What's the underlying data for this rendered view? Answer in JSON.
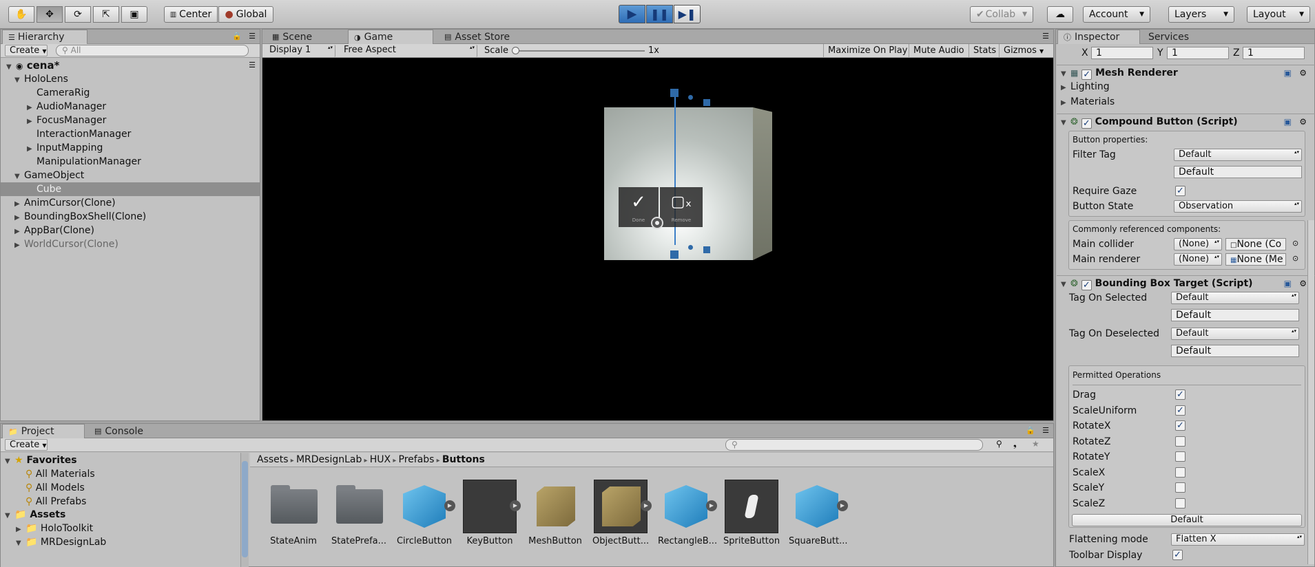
{
  "toolbar": {
    "pivot_center": "Center",
    "pivot_global": "Global",
    "collab": "Collab",
    "account": "Account",
    "layers": "Layers",
    "layout": "Layout"
  },
  "hierarchy": {
    "tab": "Hierarchy",
    "create": "Create",
    "search_placeholder": "All",
    "scene": "cena*",
    "items": [
      {
        "label": "HoloLens",
        "indent": 0,
        "arrow": "open",
        "muted": false
      },
      {
        "label": "CameraRig",
        "indent": 1,
        "arrow": "none",
        "muted": false
      },
      {
        "label": "AudioManager",
        "indent": 1,
        "arrow": "closed",
        "muted": false
      },
      {
        "label": "FocusManager",
        "indent": 1,
        "arrow": "closed",
        "muted": false
      },
      {
        "label": "InteractionManager",
        "indent": 1,
        "arrow": "none",
        "muted": false
      },
      {
        "label": "InputMapping",
        "indent": 1,
        "arrow": "closed",
        "muted": false
      },
      {
        "label": "ManipulationManager",
        "indent": 1,
        "arrow": "none",
        "muted": false
      },
      {
        "label": "GameObject",
        "indent": 0,
        "arrow": "open",
        "muted": false
      },
      {
        "label": "Cube",
        "indent": 1,
        "arrow": "none",
        "muted": false,
        "selected": true
      },
      {
        "label": "AnimCursor(Clone)",
        "indent": 0,
        "arrow": "closed",
        "muted": false
      },
      {
        "label": "BoundingBoxShell(Clone)",
        "indent": 0,
        "arrow": "closed",
        "muted": false
      },
      {
        "label": "AppBar(Clone)",
        "indent": 0,
        "arrow": "closed",
        "muted": false
      },
      {
        "label": "WorldCursor(Clone)",
        "indent": 0,
        "arrow": "closed",
        "muted": true
      }
    ]
  },
  "viewport": {
    "tabs": {
      "scene": "Scene",
      "game": "Game",
      "asset_store": "Asset Store"
    },
    "display": "Display 1",
    "aspect": "Free Aspect",
    "scale_label": "Scale",
    "scale_value": "1x",
    "maximize": "Maximize On Play",
    "mute": "Mute Audio",
    "stats": "Stats",
    "gizmos": "Gizmos",
    "appbar_done": "Done",
    "appbar_remove": "Remove"
  },
  "inspector": {
    "tab": "Inspector",
    "services": "Services",
    "x_label": "X",
    "x_value": "1",
    "y_label": "Y",
    "y_value": "1",
    "z_label": "Z",
    "z_value": "1",
    "mesh_renderer": "Mesh Renderer",
    "lighting": "Lighting",
    "materials": "Materials",
    "compound_button": "Compound Button (Script)",
    "button_properties": "Button properties:",
    "filter_tag": "Filter Tag",
    "filter_tag_value": "Default",
    "filter_tag_text": "Default",
    "require_gaze": "Require Gaze",
    "button_state": "Button State",
    "button_state_value": "Observation",
    "common_refs": "Commonly referenced components:",
    "main_collider": "Main collider",
    "main_collider_sel": "(None)",
    "main_collider_obj": "None (Co",
    "main_renderer": "Main renderer",
    "main_renderer_sel": "(None)",
    "main_renderer_obj": "None (Me",
    "bbt": "Bounding Box Target (Script)",
    "tag_on_selected": "Tag On Selected",
    "tag_on_selected_value": "Default",
    "tag_on_selected_text": "Default",
    "tag_on_deselected": "Tag On Deselected",
    "tag_on_deselected_value": "Default",
    "tag_on_deselected_text": "Default",
    "permitted_ops": "Permitted Operations",
    "ops": [
      {
        "label": "Drag",
        "checked": true
      },
      {
        "label": "ScaleUniform",
        "checked": true
      },
      {
        "label": "RotateX",
        "checked": true
      },
      {
        "label": "RotateZ",
        "checked": false
      },
      {
        "label": "RotateY",
        "checked": false
      },
      {
        "label": "ScaleX",
        "checked": false
      },
      {
        "label": "ScaleY",
        "checked": false
      },
      {
        "label": "ScaleZ",
        "checked": false
      }
    ],
    "default_button": "Default",
    "flattening_mode": "Flattening mode",
    "flattening_value": "Flatten X",
    "toolbar_display": "Toolbar Display"
  },
  "project": {
    "tab": "Project",
    "console": "Console",
    "create": "Create",
    "favorites": "Favorites",
    "fav_items": [
      "All Materials",
      "All Models",
      "All Prefabs"
    ],
    "assets": "Assets",
    "asset_folders": [
      "HoloToolkit",
      "MRDesignLab"
    ],
    "breadcrumb": [
      "Assets",
      "MRDesignLab",
      "HUX",
      "Prefabs",
      "Buttons"
    ],
    "files": [
      {
        "label": "StateAnim",
        "kind": "folder"
      },
      {
        "label": "StatePrefa...",
        "kind": "folder"
      },
      {
        "label": "CircleButton",
        "kind": "cube"
      },
      {
        "label": "KeyButton",
        "kind": "dark"
      },
      {
        "label": "MeshButton",
        "kind": "box"
      },
      {
        "label": "ObjectButt...",
        "kind": "darkbox"
      },
      {
        "label": "RectangleB...",
        "kind": "cube"
      },
      {
        "label": "SpriteButton",
        "kind": "sprite"
      },
      {
        "label": "SquareButt...",
        "kind": "cube"
      }
    ]
  }
}
